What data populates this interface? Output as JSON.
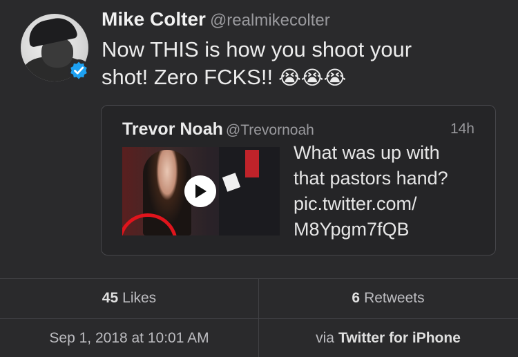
{
  "tweet": {
    "author_name": "Mike Colter",
    "author_handle": "@realmikecolter",
    "text_line1": "Now THIS is how you shoot your",
    "text_line2": "shot! Zero FCKS!!",
    "emojis": "😭😭😭"
  },
  "quoted": {
    "author_name": "Trevor Noah",
    "author_handle": "@Trevornoah",
    "time": "14h",
    "text_lines": [
      "What was up with",
      "that pastors hand?",
      "pic.twitter.com/",
      "M8Ypgm7fQB"
    ]
  },
  "stats": {
    "likes_count": "45",
    "likes_label": "Likes",
    "retweets_count": "6",
    "retweets_label": "Retweets"
  },
  "footer": {
    "timestamp": "Sep 1, 2018 at 10:01 AM",
    "via_prefix": "via",
    "source": "Twitter for iPhone"
  },
  "colors": {
    "background": "#2a2a2c",
    "verified_blue": "#1da1f2"
  }
}
